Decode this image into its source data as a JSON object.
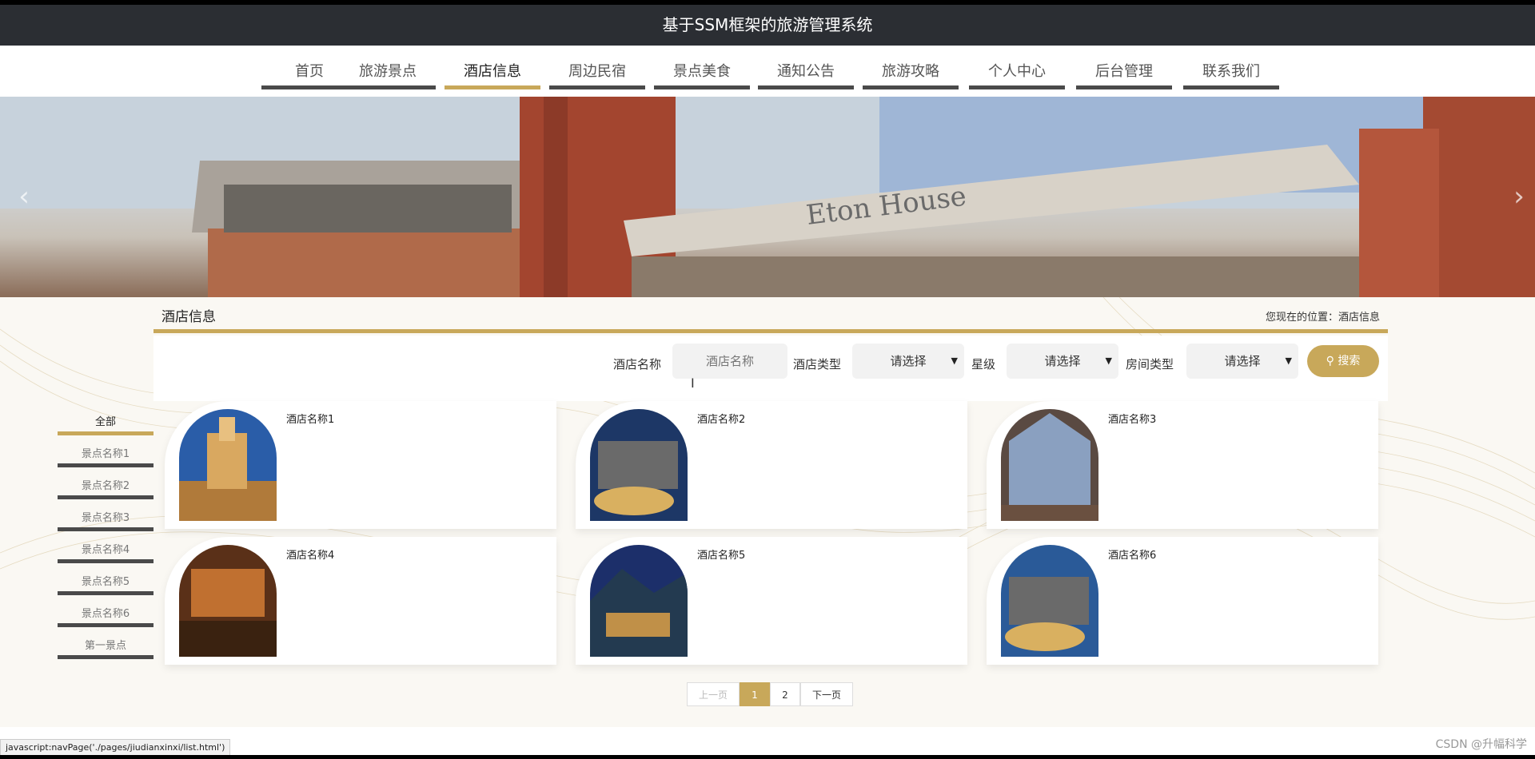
{
  "header": {
    "title": "基于SSM框架的旅游管理系统"
  },
  "nav": {
    "items": [
      "首页",
      "旅游景点",
      "酒店信息",
      "周边民宿",
      "景点美食",
      "通知公告",
      "旅游攻略",
      "个人中心",
      "后台管理",
      "联系我们"
    ],
    "active_index": 2
  },
  "banner": {
    "sign_text": "Eton House",
    "prev_arrow": "‹",
    "next_arrow": "›"
  },
  "section": {
    "title": "酒店信息",
    "breadcrumb": "您现在的位置：酒店信息"
  },
  "search": {
    "name_label": "酒店名称",
    "name_placeholder": "酒店名称",
    "type_label": "酒店类型",
    "type_value": "请选择",
    "star_label": "星级",
    "star_value": "请选择",
    "room_label": "房间类型",
    "room_value": "请选择",
    "button_label": "搜索"
  },
  "sidebar": {
    "items": [
      "全部",
      "景点名称1",
      "景点名称2",
      "景点名称3",
      "景点名称4",
      "景点名称5",
      "景点名称6",
      "第一景点"
    ],
    "active_index": 0
  },
  "hotels": [
    "酒店名称1",
    "酒店名称2",
    "酒店名称3",
    "酒店名称4",
    "酒店名称5",
    "酒店名称6"
  ],
  "pagination": {
    "prev": "上一页",
    "pages": [
      "1",
      "2"
    ],
    "current": "1",
    "next": "下一页"
  },
  "statusbar": {
    "text": "javascript:navPage('./pages/jiudianxinxi/list.html')"
  },
  "watermark": {
    "text": "CSDN @升幅科学"
  },
  "colors": {
    "accent": "#c8a85a",
    "header_bg": "#2b2e33",
    "nav_bar": "#4a4a4a"
  }
}
